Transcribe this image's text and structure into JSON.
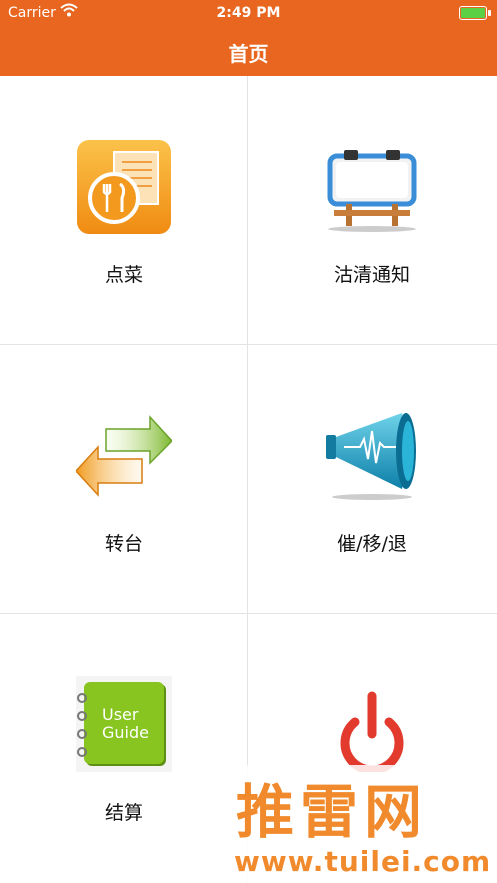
{
  "status_bar": {
    "carrier": "Carrier",
    "time": "2:49 PM"
  },
  "navbar": {
    "title": "首页"
  },
  "menu": [
    {
      "label": "点菜",
      "icon": "order-food-icon"
    },
    {
      "label": "沽清通知",
      "icon": "notice-board-icon"
    },
    {
      "label": "转台",
      "icon": "transfer-arrows-icon"
    },
    {
      "label": "催/移/退",
      "icon": "megaphone-icon"
    },
    {
      "label": "结算",
      "icon": "user-guide-book-icon",
      "icon_text": [
        "User",
        "Guide"
      ]
    },
    {
      "label": "",
      "icon": "power-icon"
    }
  ],
  "watermark": {
    "title": "推雷网",
    "url": "www.tuilei.com"
  },
  "colors": {
    "brand": "#e8661f",
    "battery": "#5cd044",
    "power": "#e23b2e"
  }
}
